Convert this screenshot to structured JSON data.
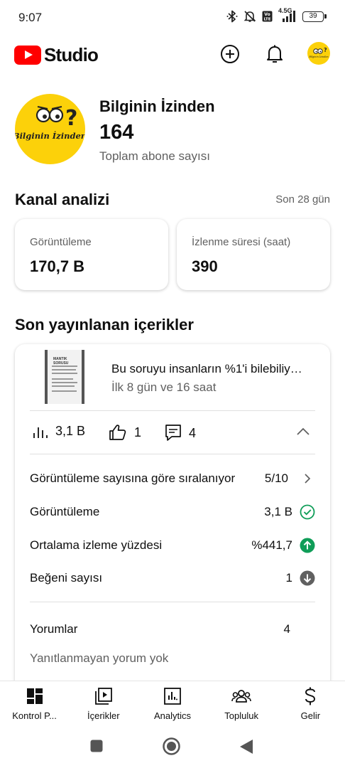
{
  "status_bar": {
    "time": "9:07",
    "network": "4.5G",
    "volte": "Vo LTE",
    "battery": "39",
    "icons": [
      "bluetooth-icon",
      "mute-icon",
      "signal-icon",
      "battery-icon"
    ]
  },
  "header": {
    "logo_text": "Studio",
    "icons": [
      "create-icon",
      "notifications-icon",
      "account-avatar"
    ]
  },
  "channel": {
    "name": "Bilginin İzinden",
    "subscribers": "164",
    "subscribers_label": "Toplam abone sayısı",
    "avatar_text": "Bilginin İzinden"
  },
  "analytics": {
    "title": "Kanal analizi",
    "period": "Son 28 gün",
    "cards": [
      {
        "label": "Görüntüleme",
        "value": "170,7 B"
      },
      {
        "label": "İzlenme süresi (saat)",
        "value": "390"
      }
    ]
  },
  "recent": {
    "title": "Son yayınlanan içerikler",
    "thumbnail_text": "MANTIK SORUSU",
    "video_title": "Bu soruyu insanların %1'i bilebiliy…",
    "video_subtitle": "İlk 8 gün ve 16 saat",
    "stats": {
      "views": "3,1 B",
      "likes": "1",
      "comments": "4"
    },
    "rows": [
      {
        "label": "Görüntüleme sayısına göre sıralanıyor",
        "value": "5/10",
        "icon": "chevron-right-icon"
      },
      {
        "label": "Görüntüleme",
        "value": "3,1 B",
        "icon": "check-circle-icon"
      },
      {
        "label": "Ortalama izleme yüzdesi",
        "value": "%441,7",
        "icon": "arrow-up-circle-icon"
      },
      {
        "label": "Beğeni sayısı",
        "value": "1",
        "icon": "arrow-down-circle-icon"
      }
    ],
    "comments_label": "Yorumlar",
    "comments_value": "4",
    "no_replies": "Yanıtlanmayan yorum yok"
  },
  "colors": {
    "brand_red": "#ff0000",
    "channel_yellow": "#fcd10a",
    "green": "#0f9d58",
    "gray_icon": "#606060"
  },
  "bottom_nav": [
    {
      "label": "Kontrol P...",
      "icon": "dashboard-icon"
    },
    {
      "label": "İçerikler",
      "icon": "content-icon"
    },
    {
      "label": "Analytics",
      "icon": "analytics-icon"
    },
    {
      "label": "Topluluk",
      "icon": "community-icon"
    },
    {
      "label": "Gelir",
      "icon": "earn-icon"
    }
  ],
  "system_nav": [
    "recents-button",
    "home-button",
    "back-button"
  ]
}
